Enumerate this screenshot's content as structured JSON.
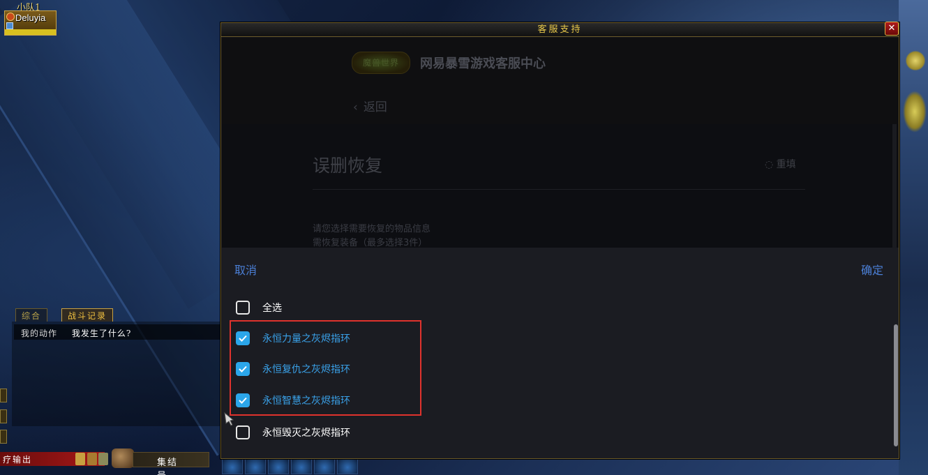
{
  "party": {
    "label": "小队1",
    "member_name": "Deluyia"
  },
  "chat": {
    "tabs": [
      {
        "label": "综合",
        "active": false
      },
      {
        "label": "战斗记录",
        "active": true
      }
    ],
    "line_items": [
      "我的动作",
      "我发生了什么?"
    ]
  },
  "bottom": {
    "red_bar_text": "疗输出",
    "rally_label": "集结号"
  },
  "dialog": {
    "title": "客服支持",
    "close_label": "✕",
    "web": {
      "logo_text": "魔兽世界",
      "site_title": "网易暴雪游戏客服中心",
      "back_label": "返回",
      "card_title": "误删恢复",
      "reset_label": "重填",
      "hint_lines": [
        "请您选择需要恢复的物品信息",
        "需恢复装备（最多选择3件）"
      ]
    },
    "picker": {
      "cancel_label": "取消",
      "confirm_label": "确定",
      "options": [
        {
          "label": "全选",
          "checked": false
        },
        {
          "label": "永恒力量之灰烬指环",
          "checked": true
        },
        {
          "label": "永恒复仇之灰烬指环",
          "checked": true
        },
        {
          "label": "永恒智慧之灰烬指环",
          "checked": true
        },
        {
          "label": "永恒毁灭之灰烬指环",
          "checked": false
        }
      ]
    }
  },
  "colors": {
    "accent_blue": "#4b7fd6",
    "checkbox_blue": "#2ba6ea",
    "highlight_red": "#e0322d",
    "wow_gold": "#e8c84a"
  }
}
